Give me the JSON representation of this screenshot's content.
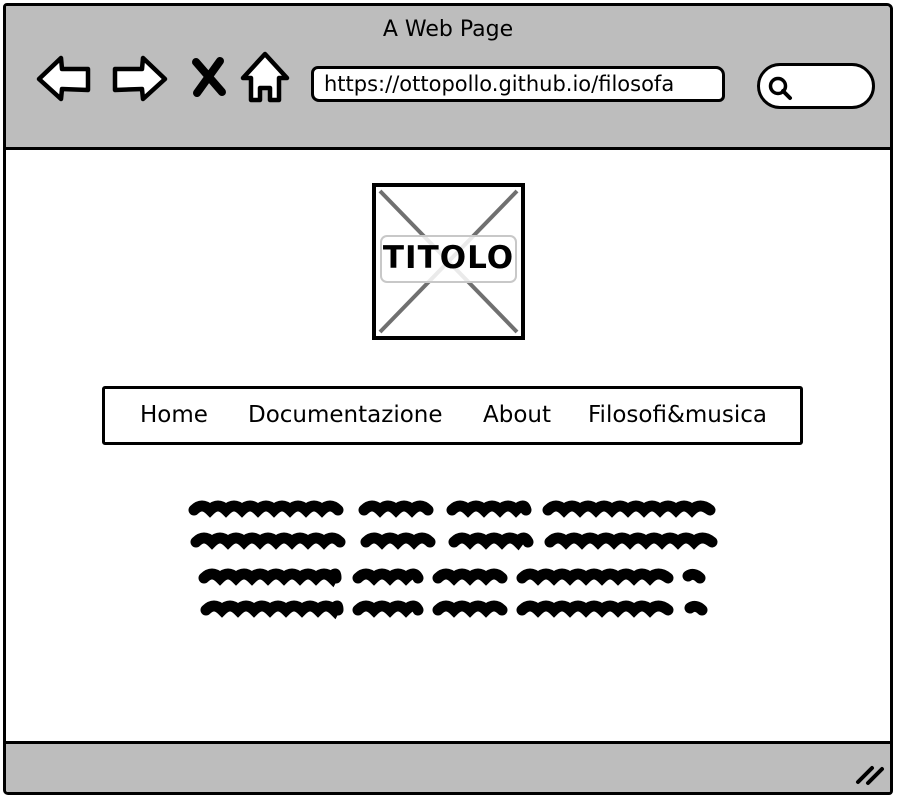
{
  "window": {
    "title": "A Web Page"
  },
  "toolbar": {
    "back_icon": "back-arrow-icon",
    "forward_icon": "forward-arrow-icon",
    "stop_icon": "close-x-icon",
    "home_icon": "home-icon",
    "address": "https://ottopollo.github.io/filosofa",
    "search_icon": "search-icon"
  },
  "page": {
    "logo_title": "TITOLO",
    "nav": [
      {
        "label": "Home"
      },
      {
        "label": "Documentazione"
      },
      {
        "label": "About"
      },
      {
        "label": "Filosofi&musica"
      }
    ]
  },
  "colors": {
    "chrome": "#bdbdbd",
    "ink": "#000000",
    "placeholder_x": "#707070"
  }
}
